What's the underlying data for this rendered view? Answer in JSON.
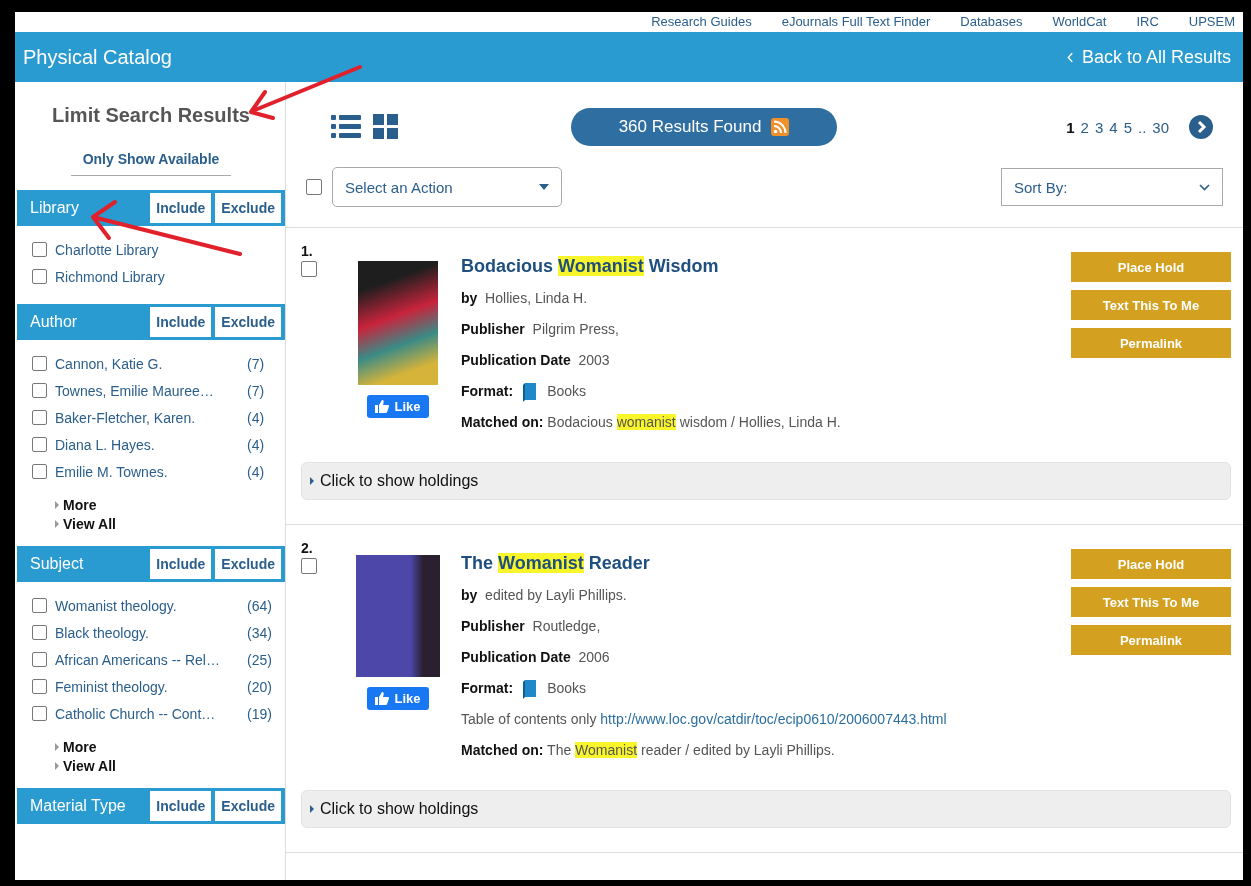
{
  "top_nav": [
    "Research Guides",
    "eJournals Full Text Finder",
    "Databases",
    "WorldCat",
    "IRC",
    "UPSEM"
  ],
  "header": {
    "title": "Physical Catalog",
    "back_link": "Back to All Results"
  },
  "sidebar": {
    "title": "Limit Search Results",
    "available_button": "Only Show Available",
    "facets": [
      {
        "name": "Library",
        "include": "Include",
        "exclude": "Exclude",
        "items": [
          {
            "label": "Charlotte Library",
            "checked": false
          },
          {
            "label": "Richmond Library",
            "checked": false
          }
        ]
      },
      {
        "name": "Author",
        "include": "Include",
        "exclude": "Exclude",
        "items": [
          {
            "label": "Cannon, Katie G.",
            "count": "(7)",
            "checked": false
          },
          {
            "label": "Townes, Emilie Mauree…",
            "count": "(7)",
            "checked": false
          },
          {
            "label": "Baker-Fletcher, Karen.",
            "count": "(4)",
            "checked": false
          },
          {
            "label": "Diana L. Hayes.",
            "count": "(4)",
            "checked": false
          },
          {
            "label": "Emilie M. Townes.",
            "count": "(4)",
            "checked": false
          }
        ],
        "more": "More",
        "view_all": "View All"
      },
      {
        "name": "Subject",
        "include": "Include",
        "exclude": "Exclude",
        "items": [
          {
            "label": "Womanist theology.",
            "count": "(64)",
            "checked": false
          },
          {
            "label": "Black theology.",
            "count": "(34)",
            "checked": false
          },
          {
            "label": "African Americans -- Rel…",
            "count": "(25)",
            "checked": false
          },
          {
            "label": "Feminist theology.",
            "count": "(20)",
            "checked": false
          },
          {
            "label": "Catholic Church -- Cont…",
            "count": "(19)",
            "checked": false
          }
        ],
        "more": "More",
        "view_all": "View All"
      },
      {
        "name": "Material Type",
        "include": "Include",
        "exclude": "Exclude"
      }
    ]
  },
  "toolbar": {
    "results": "360 Results Found",
    "select_all_checked": false,
    "action_select": "Select an Action",
    "sort_select": "Sort By:",
    "pages": [
      {
        "label": "1",
        "selected": true
      },
      {
        "label": "2",
        "selected": false
      },
      {
        "label": "3",
        "selected": false
      },
      {
        "label": "4",
        "selected": false
      },
      {
        "label": "5",
        "selected": false
      },
      {
        "label": "..",
        "selected": false
      },
      {
        "label": "30",
        "selected": false
      }
    ]
  },
  "results": [
    {
      "number": "1.",
      "checked": false,
      "title": [
        {
          "text": "Bodacious ",
          "highlighted": false
        },
        {
          "text": "Womanist",
          "highlighted": true
        },
        {
          "text": " Wisdom",
          "highlighted": false
        }
      ],
      "fields": [
        {
          "kind": "plain",
          "label": "by",
          "value": "Hollies, Linda H."
        },
        {
          "kind": "plain",
          "label": "Publisher",
          "value": "Pilgrim Press,"
        },
        {
          "kind": "plain",
          "label": "Publication Date",
          "value": "2003"
        },
        {
          "kind": "format",
          "label": "Format:",
          "value": "Books"
        },
        {
          "kind": "matched",
          "label": "Matched on:",
          "segments": [
            {
              "text": "Bodacious ",
              "highlighted": false
            },
            {
              "text": "womanist",
              "highlighted": true
            },
            {
              "text": " wisdom / Hollies, Linda H.",
              "highlighted": false
            }
          ]
        }
      ],
      "like": "Like",
      "buttons": [
        "Place Hold",
        "Text This To Me",
        "Permalink"
      ],
      "holdings": "Click to show holdings"
    },
    {
      "number": "2.",
      "checked": false,
      "title": [
        {
          "text": "The ",
          "highlighted": false
        },
        {
          "text": "Womanist",
          "highlighted": true
        },
        {
          "text": " Reader",
          "highlighted": false
        }
      ],
      "fields": [
        {
          "kind": "plain",
          "label": "by",
          "value": "edited by Layli Phillips."
        },
        {
          "kind": "plain",
          "label": "Publisher",
          "value": "Routledge,"
        },
        {
          "kind": "plain",
          "label": "Publication Date",
          "value": "2006"
        },
        {
          "kind": "format",
          "label": "Format:",
          "value": "Books"
        },
        {
          "kind": "note",
          "value": "Table of contents only",
          "link": "http://www.loc.gov/catdir/toc/ecip0610/2006007443.html"
        },
        {
          "kind": "matched",
          "label": "Matched on:",
          "segments": [
            {
              "text": "The ",
              "highlighted": false
            },
            {
              "text": "Womanist",
              "highlighted": true
            },
            {
              "text": " reader / edited by Layli Phillips.",
              "highlighted": false
            }
          ]
        }
      ],
      "like": "Like",
      "buttons": [
        "Place Hold",
        "Text This To Me",
        "Permalink"
      ],
      "holdings": "Click to show holdings"
    }
  ]
}
